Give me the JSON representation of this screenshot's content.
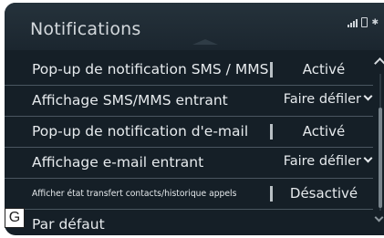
{
  "header": {
    "title": "Notifications",
    "status_icons": [
      "signal-icon",
      "phone-icon",
      "bluetooth-icon"
    ]
  },
  "rows": [
    {
      "label": "Pop-up de notification SMS / MMS",
      "value": "Activé"
    },
    {
      "label": "Affichage SMS/MMS entrant",
      "value": "Faire défiler"
    },
    {
      "label": "Pop-up de notification d'e-mail",
      "value": "Activé"
    },
    {
      "label": "Affichage e-mail entrant",
      "value": "Faire défiler"
    },
    {
      "label": "Afficher état transfert contacts/historique appels",
      "value": "Désactivé"
    },
    {
      "label": "Par défaut"
    }
  ],
  "callout": {
    "letter": "G"
  },
  "colors": {
    "background": "#151f27",
    "header": "#25323b",
    "text": "#e6eaed"
  }
}
